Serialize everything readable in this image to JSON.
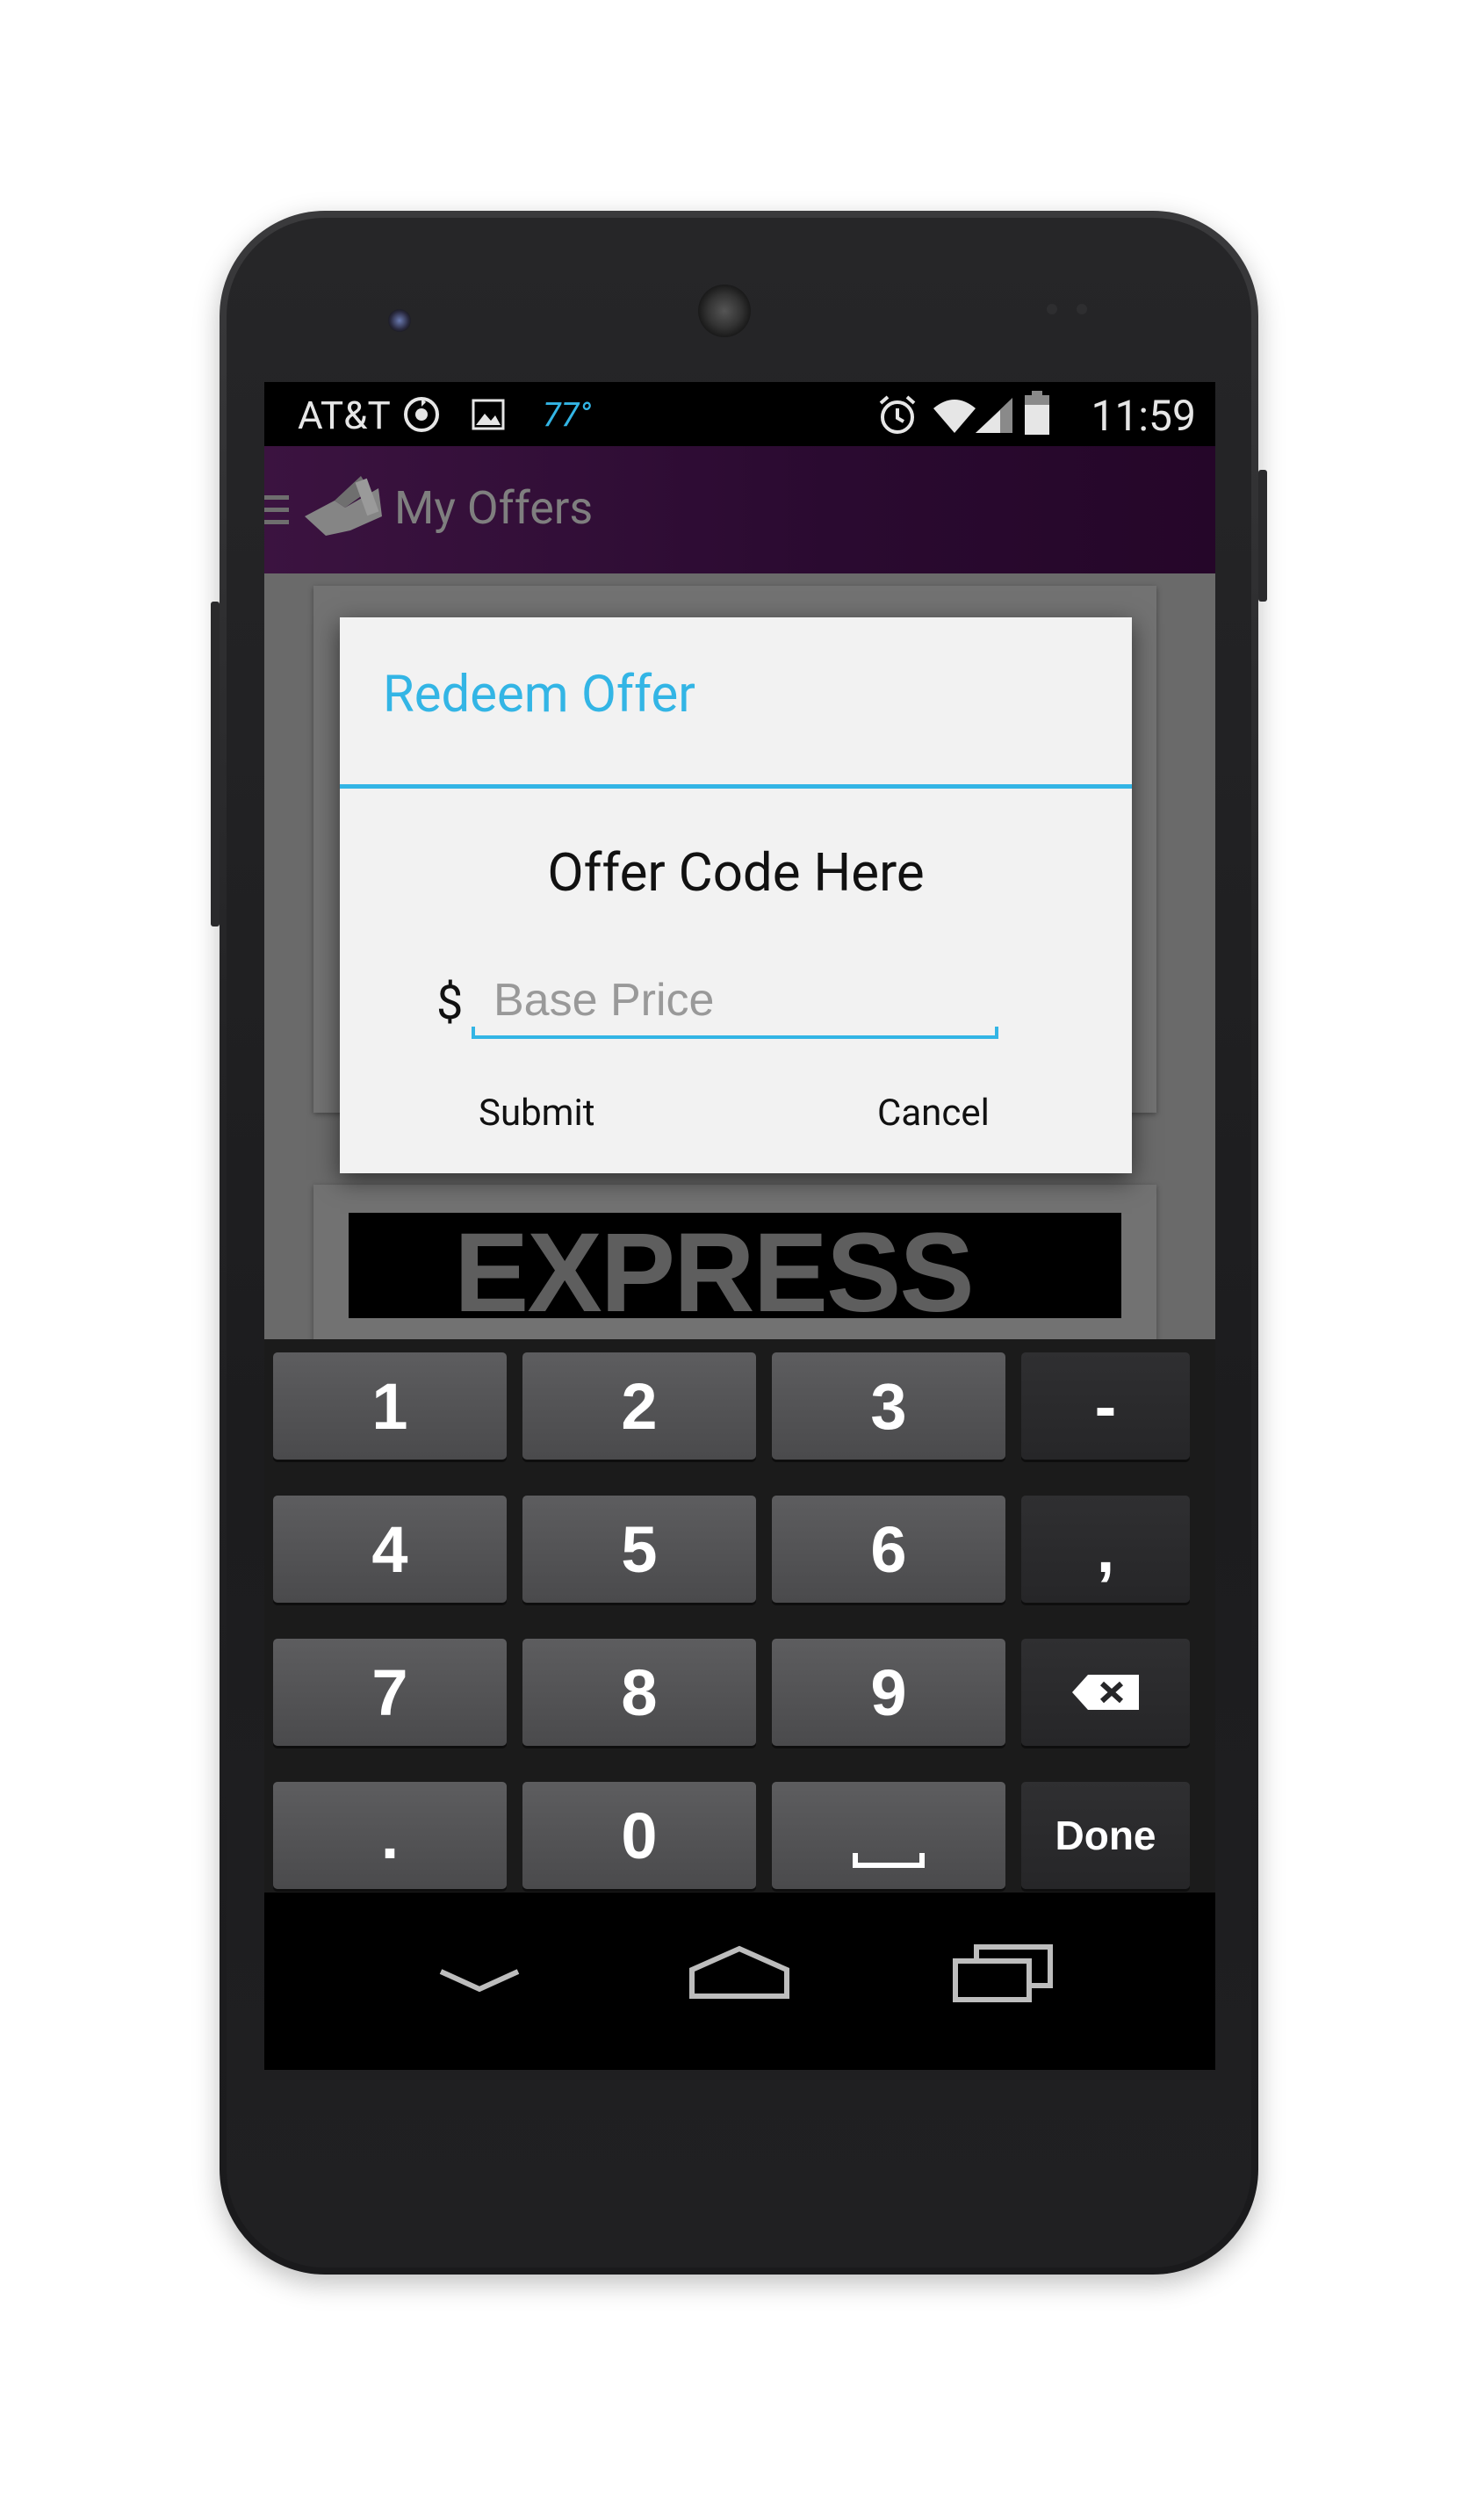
{
  "status_bar": {
    "carrier": "AT&T",
    "temperature": "77°",
    "time": "11:59",
    "icons": [
      "sync-icon",
      "picture-notification-icon",
      "alarm-icon",
      "wifi-icon",
      "cell-signal-icon",
      "battery-icon"
    ]
  },
  "action_bar": {
    "title": "My Offers",
    "icons": [
      "drawer-indicator-icon",
      "app-logo-icon"
    ],
    "color": "#2a0a30"
  },
  "background_card": {
    "brand_text": "EXPRESS"
  },
  "dialog": {
    "title": "Redeem Offer",
    "offer_code": "Offer Code Here",
    "currency_symbol": "$",
    "price_input": {
      "value": "",
      "placeholder": "Base Price"
    },
    "submit_label": "Submit",
    "cancel_label": "Cancel",
    "accent_color": "#33b5e5"
  },
  "keyboard": {
    "rows": [
      [
        "1",
        "2",
        "3",
        "-"
      ],
      [
        "4",
        "5",
        "6",
        ","
      ],
      [
        "7",
        "8",
        "9",
        "backspace"
      ],
      [
        ".",
        "0",
        "space",
        "Done"
      ]
    ],
    "done_label": "Done"
  },
  "nav_bar": {
    "icons": [
      "hide-keyboard-icon",
      "home-icon",
      "recent-apps-icon"
    ]
  }
}
